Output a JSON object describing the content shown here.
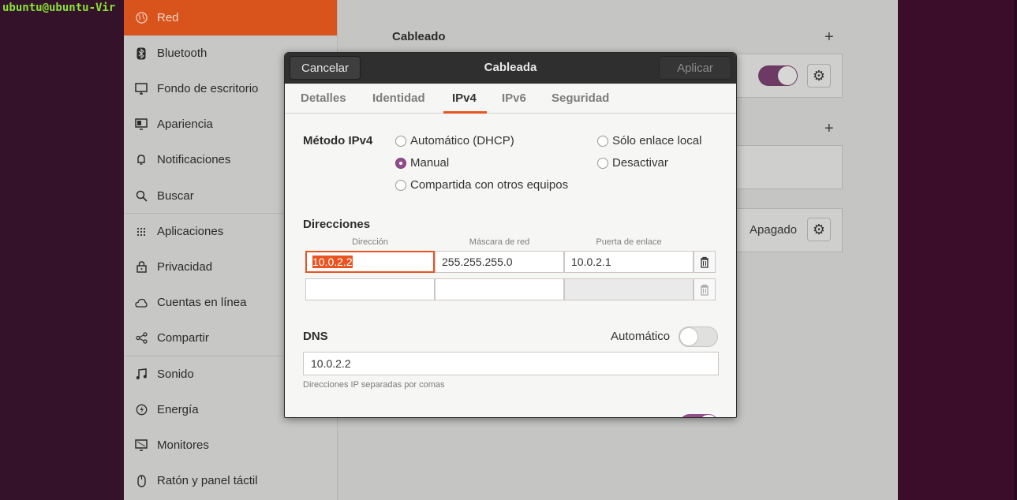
{
  "terminal": {
    "prompt": "ubuntu@ubuntu-Vir"
  },
  "sidebar": {
    "items": [
      {
        "label": "Red",
        "icon": "globe-icon",
        "active": true
      },
      {
        "label": "Bluetooth",
        "icon": "bluetooth-icon"
      },
      {
        "label": "Fondo de escritorio",
        "icon": "monitor-icon"
      },
      {
        "label": "Apariencia",
        "icon": "appearance-icon"
      },
      {
        "label": "Notificaciones",
        "icon": "bell-icon"
      },
      {
        "label": "Buscar",
        "icon": "search-icon"
      },
      {
        "label": "Aplicaciones",
        "icon": "apps-grid-icon"
      },
      {
        "label": "Privacidad",
        "icon": "lock-icon"
      },
      {
        "label": "Cuentas en línea",
        "icon": "cloud-icon"
      },
      {
        "label": "Compartir",
        "icon": "share-icon"
      },
      {
        "label": "Sonido",
        "icon": "music-note-icon"
      },
      {
        "label": "Energía",
        "icon": "power-icon"
      },
      {
        "label": "Monitores",
        "icon": "display-icon"
      },
      {
        "label": "Ratón y panel táctil",
        "icon": "mouse-icon"
      }
    ]
  },
  "content": {
    "wired_title": "Cableado",
    "vpn_status": "Apagado"
  },
  "dialog": {
    "title": "Cableada",
    "cancel_label": "Cancelar",
    "apply_label": "Aplicar",
    "tabs": [
      "Detalles",
      "Identidad",
      "IPv4",
      "IPv6",
      "Seguridad"
    ],
    "active_tab": "IPv4",
    "method": {
      "label": "Método IPv4",
      "options": [
        "Automático (DHCP)",
        "Manual",
        "Compartida con otros equipos",
        "Sólo enlace local",
        "Desactivar"
      ],
      "selected": "Manual"
    },
    "addresses": {
      "label": "Direcciones",
      "headers": [
        "Dirección",
        "Máscara de red",
        "Puerta de enlace"
      ],
      "rows": [
        [
          "10.0.2.2",
          "255.255.255.0",
          "10.0.2.1"
        ],
        [
          "",
          "",
          ""
        ]
      ]
    },
    "dns": {
      "label": "DNS",
      "auto_label": "Automático",
      "auto_enabled": false,
      "value": "10.0.2.2",
      "hint": "Direcciones IP separadas por comas"
    }
  },
  "colors": {
    "accent": "#e95420",
    "radio_selected": "#924d8b",
    "titlebar": "#2f2f2f"
  }
}
